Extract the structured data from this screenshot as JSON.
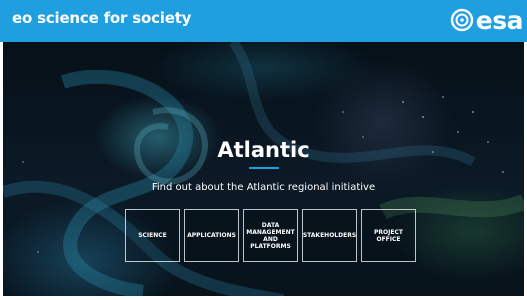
{
  "header": {
    "site_title": "eo science for society",
    "logo_text": "esa",
    "logo_icon": "esa-logo-mark-icon",
    "bar_color": "#1f9fe0"
  },
  "hero": {
    "title": "Atlantic",
    "subtitle": "Find out about the Atlantic regional initiative",
    "accent_color": "#1f9fe0"
  },
  "nav": {
    "buttons": [
      {
        "label": "SCIENCE"
      },
      {
        "label": "APPLICATIONS"
      },
      {
        "label": "DATA MANAGEMENT AND PLATFORMS"
      },
      {
        "label": "STAKEHOLDERS"
      },
      {
        "label": "PROJECT OFFICE"
      }
    ]
  }
}
